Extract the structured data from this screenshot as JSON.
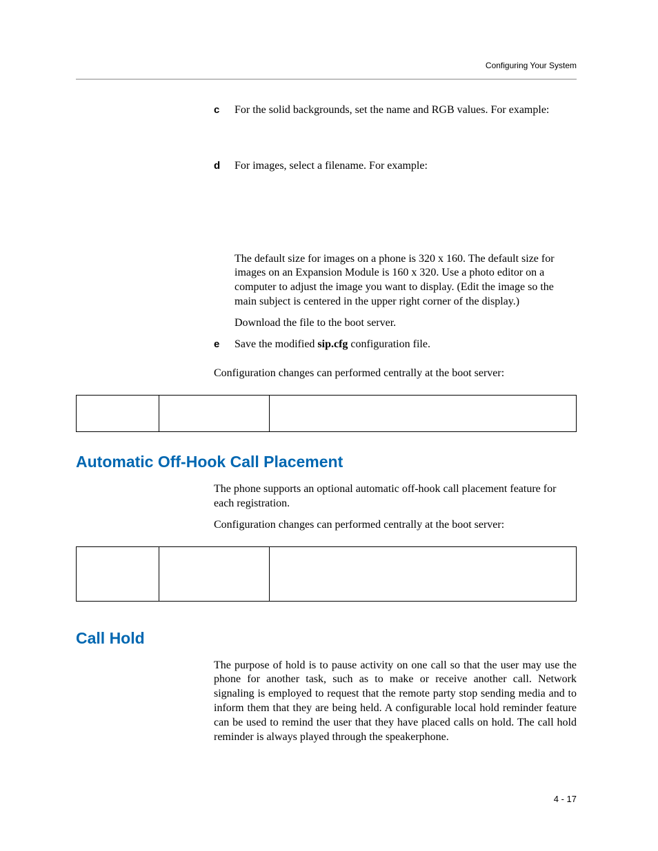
{
  "header": {
    "running_title": "Configuring Your System"
  },
  "steps": {
    "c": {
      "marker": "c",
      "text": "For the solid backgrounds, set the name and RGB values. For example:"
    },
    "d": {
      "marker": "d",
      "text": "For images, select a filename. For example:",
      "para1": "The default size for images on a phone is 320 x 160. The default size for images on an Expansion Module is 160 x 320. Use a photo editor on a computer to adjust the image you want to display. (Edit the image so the main subject is centered in the upper right corner of the display.)",
      "para2": "Download the file to the boot server."
    },
    "e": {
      "marker": "e",
      "text_before": "Save the modified ",
      "bold": "sip.cfg",
      "text_after": " configuration file."
    }
  },
  "post_steps_para": "Configuration changes can performed centrally at the boot server:",
  "sections": {
    "offhook": {
      "heading": "Automatic Off-Hook Call Placement",
      "para1": "The phone supports an optional automatic off-hook call placement feature for each registration.",
      "para2": "Configuration changes can performed centrally at the boot server:"
    },
    "callhold": {
      "heading": "Call Hold",
      "para1": "The purpose of hold is to pause activity on one call so that the user may use the phone for another task, such as to make or receive another call. Network signaling is employed to request that the remote party stop sending media and to inform them that they are being held. A configurable local hold reminder feature can be used to remind the user that they have placed calls on hold. The call hold reminder is always played through the speakerphone."
    }
  },
  "page_number": "4 - 17"
}
